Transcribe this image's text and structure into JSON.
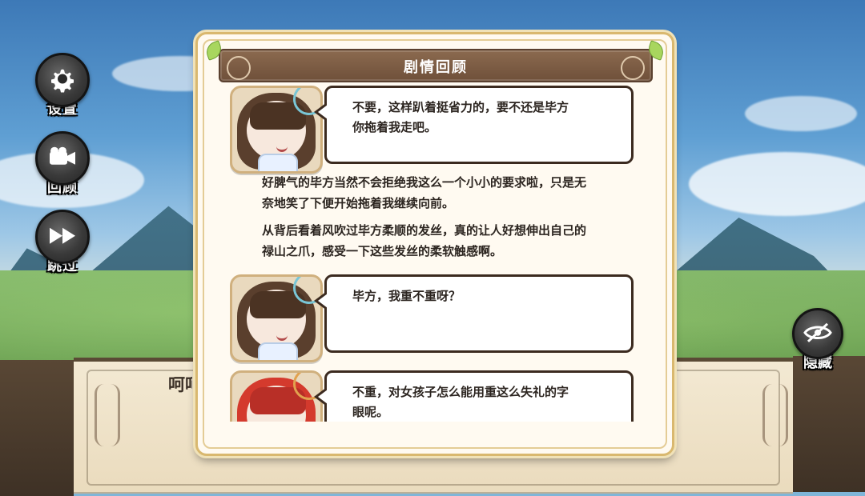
{
  "side_buttons": [
    {
      "label": "设置",
      "icon": "gear-icon"
    },
    {
      "label": "回顾",
      "icon": "camera-icon"
    },
    {
      "label": "跳过",
      "icon": "fast-forward-icon"
    }
  ],
  "hide_button": {
    "label": "隐藏",
    "icon": "eye-off-icon"
  },
  "background_dialog": {
    "text_fragment": "呵呵"
  },
  "panel": {
    "title": "剧情回顾",
    "entries": [
      {
        "type": "speech",
        "portrait": "brown-haired-girl",
        "text_line1": "不要，这样趴着挺省力的，要不还是毕方",
        "text_line2": "你拖着我走吧。"
      },
      {
        "type": "narration",
        "text_line1": "好脾气的毕方当然不会拒绝我这么一个小小的要求啦，只是无",
        "text_line2": "奈地笑了下便开始拖着我继续向前。"
      },
      {
        "type": "narration",
        "text_line1": "从背后看着风吹过毕方柔顺的发丝，真的让人好想伸出自己的",
        "text_line2": "禄山之爪，感受一下这些发丝的柔软触感啊。"
      },
      {
        "type": "speech",
        "portrait": "brown-haired-girl",
        "text_line1": "毕方，我重不重呀？",
        "text_line2": ""
      },
      {
        "type": "speech",
        "portrait": "red-haired-boy",
        "text_line1": "不重，对女孩子怎么能用重这么失礼的字",
        "text_line2": "眼呢。"
      }
    ]
  },
  "colors": {
    "panel_bg": "#fffaf1",
    "panel_border": "#d9b86f",
    "title_bar": "#7b5a41",
    "text": "#2c2520"
  }
}
